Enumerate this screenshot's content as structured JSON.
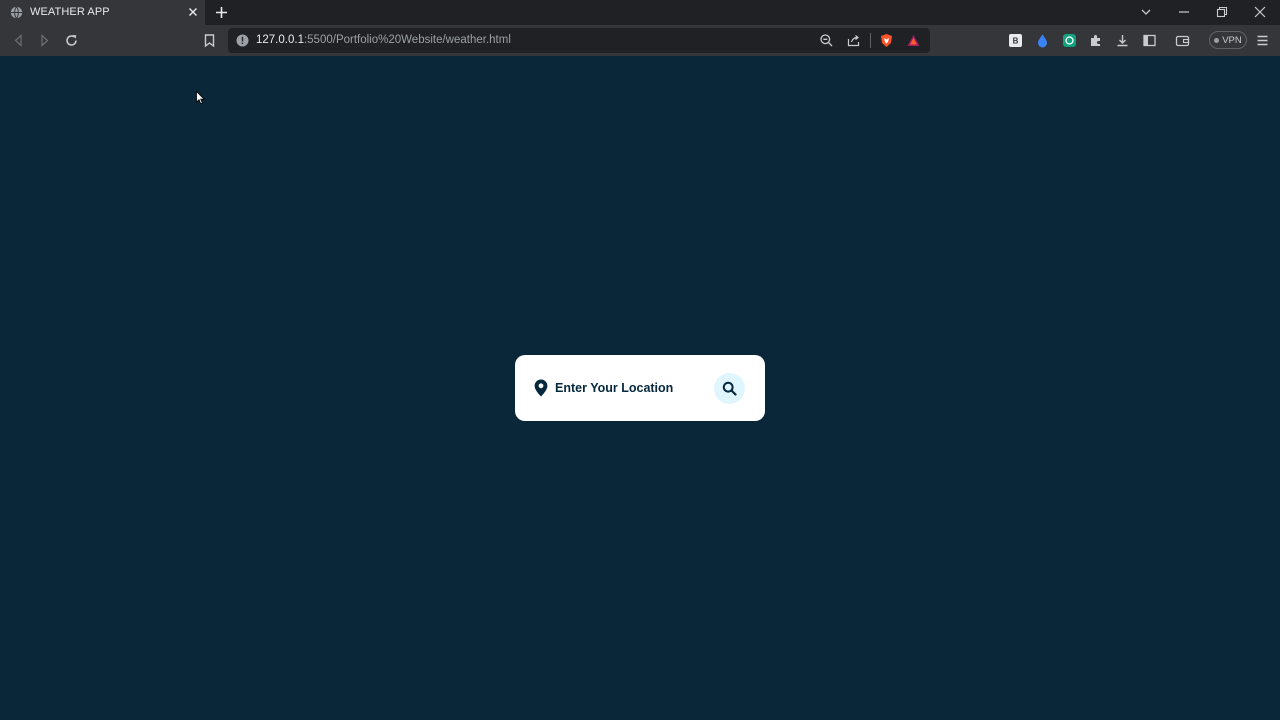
{
  "browser": {
    "tab": {
      "title": "WEATHER APP"
    },
    "address_bar": {
      "host": "127.0.0.1",
      "path": ":5500/Portfolio%20Website/weather.html"
    },
    "vpn_label": "VPN"
  },
  "search": {
    "placeholder": "Enter Your Location",
    "value": ""
  },
  "icons": {
    "location": "location-pin-icon",
    "search": "search-icon"
  },
  "colors": {
    "page_background": "#0a2639",
    "card": "#ffffff",
    "text": "#06283d",
    "search_button_bg": "#dff6ff"
  }
}
